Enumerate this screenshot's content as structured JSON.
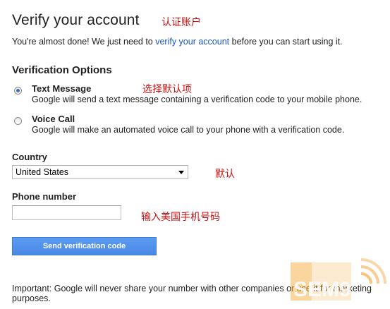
{
  "header": {
    "title": "Verify your account",
    "title_annotation": "认证账户"
  },
  "intro": {
    "prefix": "You're almost done! We just need to ",
    "link": "verify your account",
    "suffix": " before you can start using it."
  },
  "options": {
    "heading": "Verification Options",
    "annotation": "选择默认项",
    "items": [
      {
        "label": "Text Message",
        "description": "Google will send a text message containing a verification code to your mobile phone.",
        "selected": true
      },
      {
        "label": "Voice Call",
        "description": "Google will make an automated voice call to your phone with a verification code.",
        "selected": false
      }
    ]
  },
  "country": {
    "label": "Country",
    "value": "United States",
    "annotation": "默认"
  },
  "phone": {
    "label": "Phone number",
    "value": "",
    "annotation": "输入美国手机号码"
  },
  "submit": {
    "label": "Send verification code"
  },
  "footer": {
    "text": "Important: Google will never share your number with other companies or use it for marketing purposes."
  },
  "watermark": {
    "text": "SEM9"
  },
  "colors": {
    "link": "#1a55b8",
    "button": "#4a88e6",
    "annotation": "#cc1111",
    "watermark": "#f39c2b"
  }
}
